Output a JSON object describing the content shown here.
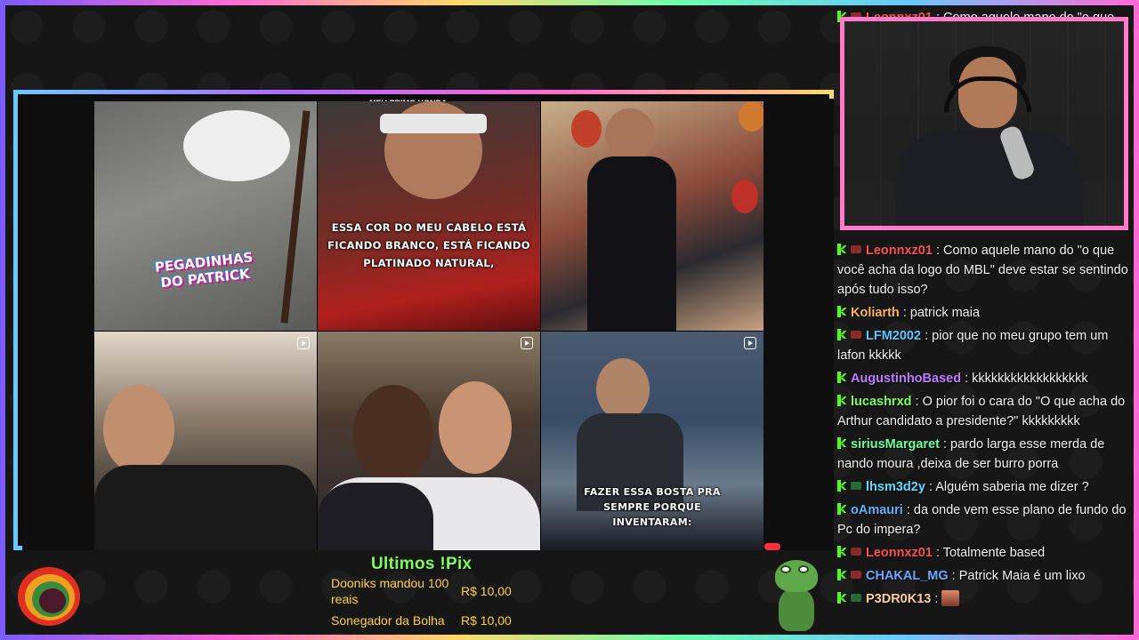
{
  "colors": {
    "kick_green": "#53fc18",
    "pix_title": "#7cff5a",
    "pix_text": "#ffd23a",
    "cam_border": "#ff7ac8"
  },
  "screen_share": {
    "top_text": "MEU PRIMO HONDA",
    "tiles": [
      {
        "caption": "",
        "logo": [
          "PEGADINHAS",
          "DO PATRICK"
        ]
      },
      {
        "caption": "ESSA COR DO MEU CABELO ESTÁ\nFICANDO BRANCO, ESTÁ FICANDO\nPLATINADO NATURAL,"
      },
      {
        "caption": ""
      },
      {
        "caption": ""
      },
      {
        "caption": ""
      },
      {
        "caption": "FAZER ESSA BOSTA PRA\nSEMPRE PORQUE\nINVENTARAM:"
      }
    ]
  },
  "chat": {
    "messages": [
      {
        "user": "Leonnxz01",
        "color": "#ff5050",
        "text": ": Como aquele mano do \"o que",
        "sub": true
      },
      {
        "user": "Leonnxz01",
        "color": "#ff5050",
        "text": ": Como aquele mano do \"o que você acha da logo do MBL\" deve estar se sentindo após tudo isso?",
        "sub": true
      },
      {
        "user": "Koliarth",
        "color": "#ffb35a",
        "text": ": patrick maia",
        "sub": false
      },
      {
        "user": "LFM2002",
        "color": "#5ac8ff",
        "text": ": pior que no meu grupo tem um lafon kkkkk",
        "sub": true
      },
      {
        "user": "AugustinhoBased",
        "color": "#c07aff",
        "text": ": kkkkkkkkkkkkkkkkkk",
        "sub": false
      },
      {
        "user": "lucashrxd",
        "color": "#7cff5a",
        "text": ": O pior foi o cara do \"O que acha do Arthur candidato a presidente?\" kkkkkkkkk",
        "sub": false
      },
      {
        "user": "siriusMargaret",
        "color": "#6aff9a",
        "text": ": pardo larga esse merda de nando moura ,deixa de ser burro porra",
        "sub": false
      },
      {
        "user": "lhsm3d2y",
        "color": "#5adcff",
        "text": ": Alguém saberia me dizer ?",
        "sub": true
      },
      {
        "user": "oAmauri",
        "color": "#5ab4ff",
        "text": ": da onde vem esse plano de fundo do Pc do impera?",
        "sub": false
      },
      {
        "user": "Leonnxz01",
        "color": "#ff5050",
        "text": ": Totalmente based",
        "sub": true
      },
      {
        "user": "CHAKAL_MG",
        "color": "#6aa8ff",
        "text": ": Patrick Maia é um lixo",
        "sub": true
      },
      {
        "user": "P3DR0K13",
        "color": "#ffd0a0",
        "text": ":",
        "sub": true,
        "emote": true
      }
    ]
  },
  "pix": {
    "title": "Ultimos !Pix",
    "donations": [
      {
        "name": "Dooniks mandou 100 reais",
        "amount": "R$ 10,00"
      },
      {
        "name": "Sonegador da Bolha",
        "amount": "R$ 10,00"
      }
    ]
  }
}
